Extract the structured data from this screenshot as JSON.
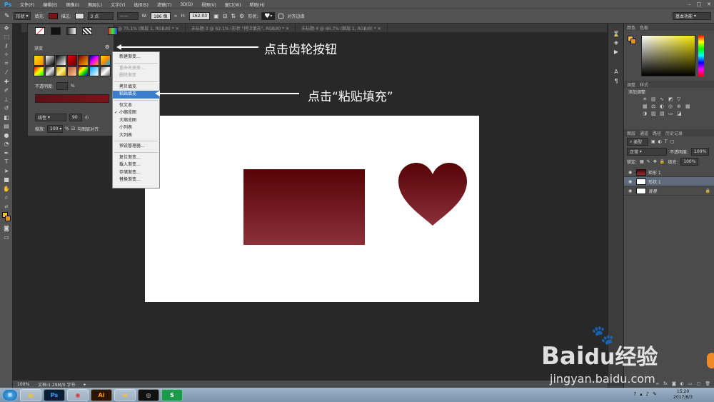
{
  "menubar": {
    "app_icon": "Ps",
    "items": [
      "文件(F)",
      "编辑(E)",
      "图像(I)",
      "图层(L)",
      "文字(Y)",
      "选择(S)",
      "滤镜(T)",
      "3D(D)",
      "视图(V)",
      "窗口(W)",
      "帮助(H)"
    ]
  },
  "optionsbar": {
    "mode": "形状",
    "fill_label": "填充:",
    "stroke_label": "描边:",
    "stroke_size": "3 点",
    "w_label": "W:",
    "w_value": "186 像",
    "h_label": "H:",
    "h_value": "162.03",
    "shape_label": "形状:",
    "align_label": "对齐边缘",
    "workspace": "基本功能"
  },
  "tabs": [
    "@ 75.1% (图层 1, RGB/8) *",
    "未标题-3 @ 62.1% (形状 \"拷贝填充\", RGB/8) *",
    "未标题-4 @ 66.7% (图层 1, RGB/8) *"
  ],
  "gradient_popup": {
    "title": "渐变",
    "opacity_label": "不透明度:",
    "opacity_unit": "%",
    "style_value": "线性",
    "angle_value": "90",
    "scale_label": "缩放:",
    "scale_value": "100",
    "scale_unit": "%",
    "align_layer_label": "与图层对齐"
  },
  "context_menu": {
    "items": [
      {
        "label": "新建渐变...",
        "state": "normal"
      },
      {
        "sep": true
      },
      {
        "label": "重命名渐变...",
        "state": "disabled"
      },
      {
        "label": "删除渐变",
        "state": "disabled"
      },
      {
        "sep": true
      },
      {
        "label": "拷贝填充",
        "state": "normal"
      },
      {
        "label": "粘贴填充",
        "state": "selected"
      },
      {
        "sep": true
      },
      {
        "label": "仅文本",
        "state": "normal"
      },
      {
        "label": "小缩览图",
        "state": "checked"
      },
      {
        "label": "大缩览图",
        "state": "normal"
      },
      {
        "label": "小列表",
        "state": "normal"
      },
      {
        "label": "大列表",
        "state": "normal"
      },
      {
        "sep": true
      },
      {
        "label": "预设管理器...",
        "state": "normal"
      },
      {
        "sep": true
      },
      {
        "label": "复位渐变...",
        "state": "normal"
      },
      {
        "label": "载入渐变...",
        "state": "normal"
      },
      {
        "label": "存储渐变...",
        "state": "normal"
      },
      {
        "label": "替换渐变...",
        "state": "normal"
      }
    ]
  },
  "annotations": {
    "gear": "点击齿轮按钮",
    "paste": "点击“粘贴填充”"
  },
  "right_panel": {
    "color_tabs": [
      "颜色",
      "色板"
    ],
    "adjust_tabs": [
      "调整",
      "样式"
    ],
    "adjust_add": "添加调整",
    "layers_tabs": [
      "图层",
      "通道",
      "路径",
      "历史记录"
    ],
    "kind_label": "类型",
    "blend_mode": "正常",
    "opacity_label": "不透明度:",
    "opacity_value": "100%",
    "lock_label": "锁定:",
    "fill_label": "填充:",
    "fill_value": "100%",
    "layers": [
      {
        "name": "矩形 1",
        "active": false
      },
      {
        "name": "形状 1",
        "active": true
      },
      {
        "name": "背景",
        "active": false
      }
    ]
  },
  "status": {
    "zoom": "100%",
    "doc": "文档:1.29M/0 字节"
  },
  "taskbar": {
    "apps": [
      "Ps",
      "Ai",
      "S"
    ],
    "time": "15:20",
    "date": "2017/8/3"
  },
  "watermark": {
    "brand": "Bai",
    "brand2": "经验",
    "url": "jingyan.baidu.com"
  },
  "colors": {
    "accent": "#3b7ccd",
    "shape_dark": "#560306",
    "shape_light": "#8c3038"
  }
}
